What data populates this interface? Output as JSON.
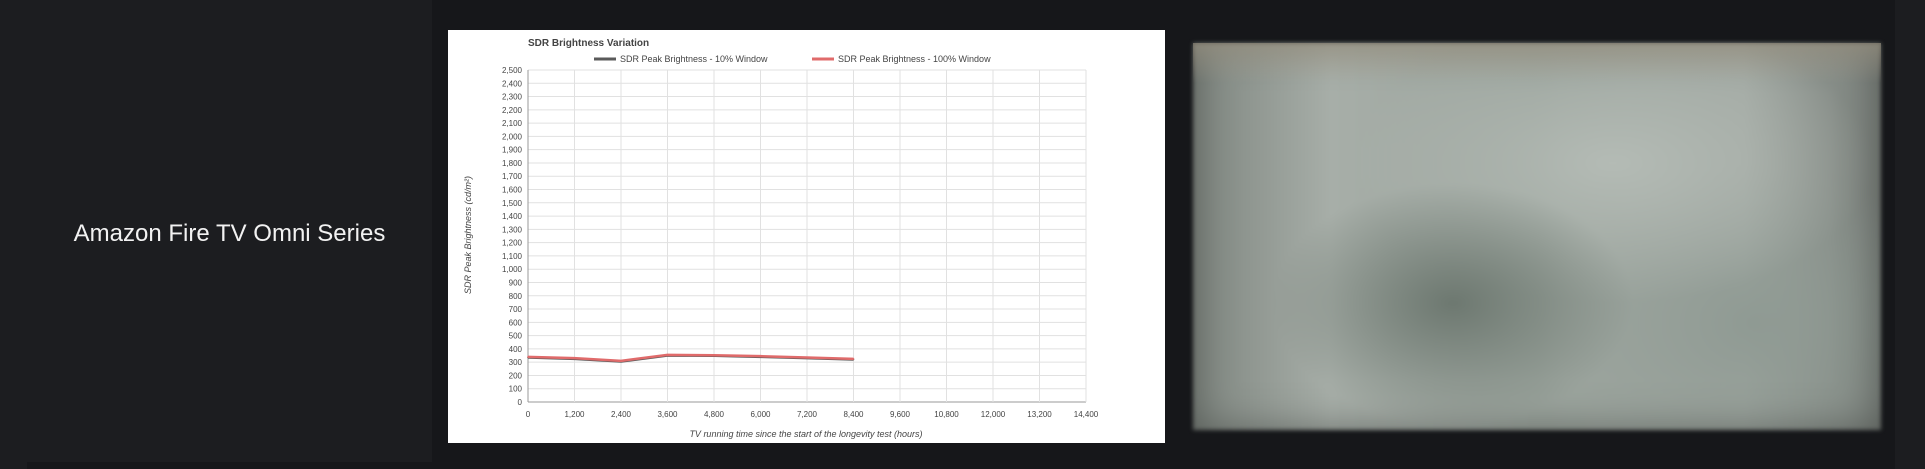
{
  "row": {
    "model_name": "Amazon Fire TV Omni Series"
  },
  "photo": {
    "description_icon": "blurred-tv-screen-photo"
  },
  "chart_data": {
    "type": "line",
    "title": "SDR Brightness Variation",
    "xlabel": "TV running time since the start of the longevity test (hours)",
    "ylabel": "SDR Peak Brightness (cd/m²)",
    "xlim": [
      0,
      14400
    ],
    "ylim": [
      0,
      2500
    ],
    "x_ticks": [
      0,
      1200,
      2400,
      3600,
      4800,
      6000,
      7200,
      8400,
      9600,
      10800,
      12000,
      13200,
      14400
    ],
    "x_tick_labels": [
      "0",
      "1,200",
      "2,400",
      "3,600",
      "4,800",
      "6,000",
      "7,200",
      "8,400",
      "9,600",
      "10,800",
      "12,000",
      "13,200",
      "14,400"
    ],
    "y_ticks": [
      0,
      100,
      200,
      300,
      400,
      500,
      600,
      700,
      800,
      900,
      1000,
      1100,
      1200,
      1300,
      1400,
      1500,
      1600,
      1700,
      1800,
      1900,
      2000,
      2100,
      2200,
      2300,
      2400,
      2500
    ],
    "y_tick_labels": [
      "0",
      "100",
      "200",
      "300",
      "400",
      "500",
      "600",
      "700",
      "800",
      "900",
      "1,000",
      "1,100",
      "1,200",
      "1,300",
      "1,400",
      "1,500",
      "1,600",
      "1,700",
      "1,800",
      "1,900",
      "2,000",
      "2,100",
      "2,200",
      "2,300",
      "2,400",
      "2,500"
    ],
    "grid": true,
    "legend_position": "top",
    "series": [
      {
        "name": "SDR Peak Brightness - 10% Window",
        "color": "#5a5a5a",
        "x": [
          0,
          1200,
          2400,
          3600,
          4800,
          6000,
          7200,
          8400
        ],
        "y": [
          335,
          325,
          305,
          350,
          348,
          340,
          330,
          320
        ]
      },
      {
        "name": "SDR Peak Brightness - 100% Window",
        "color": "#e06b6b",
        "x": [
          0,
          1200,
          2400,
          3600,
          4800,
          6000,
          7200,
          8400
        ],
        "y": [
          340,
          330,
          310,
          355,
          352,
          345,
          335,
          325
        ]
      }
    ]
  }
}
